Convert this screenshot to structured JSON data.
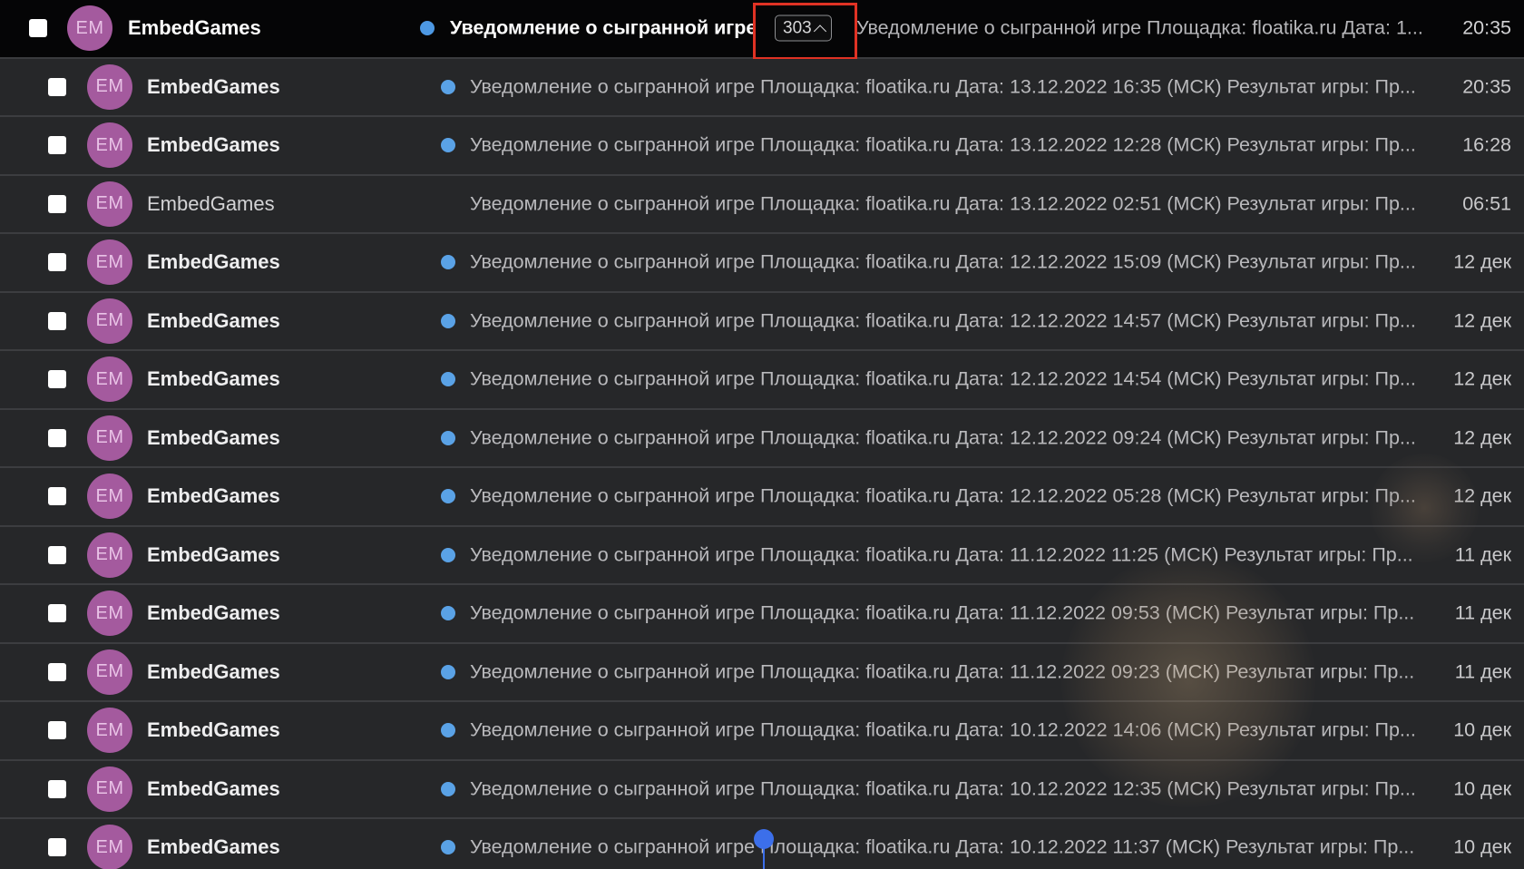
{
  "thread_header": {
    "sender": "EmbedGames",
    "avatar_initials": "EM",
    "subject": "Уведомление о сыгранной игре",
    "count": "303",
    "preview": "Уведомление о сыгранной игре Площадка: floatika.ru Дата: 1...",
    "time": "20:35"
  },
  "messages": [
    {
      "sender": "EmbedGames",
      "avatar_initials": "EM",
      "unread": true,
      "text": "Уведомление о сыгранной игре Площадка: floatika.ru Дата: 13.12.2022 16:35 (МСК) Результат игры: Пр...",
      "time": "20:35"
    },
    {
      "sender": "EmbedGames",
      "avatar_initials": "EM",
      "unread": true,
      "text": "Уведомление о сыгранной игре Площадка: floatika.ru Дата: 13.12.2022 12:28 (МСК) Результат игры: Пр...",
      "time": "16:28"
    },
    {
      "sender": "EmbedGames",
      "avatar_initials": "EM",
      "unread": false,
      "text": "Уведомление о сыгранной игре Площадка: floatika.ru Дата: 13.12.2022 02:51 (МСК) Результат игры: Пр...",
      "time": "06:51"
    },
    {
      "sender": "EmbedGames",
      "avatar_initials": "EM",
      "unread": true,
      "text": "Уведомление о сыгранной игре Площадка: floatika.ru Дата: 12.12.2022 15:09 (МСК) Результат игры: Пр...",
      "time": "12 дек"
    },
    {
      "sender": "EmbedGames",
      "avatar_initials": "EM",
      "unread": true,
      "text": "Уведомление о сыгранной игре Площадка: floatika.ru Дата: 12.12.2022 14:57 (МСК) Результат игры: Пр...",
      "time": "12 дек"
    },
    {
      "sender": "EmbedGames",
      "avatar_initials": "EM",
      "unread": true,
      "text": "Уведомление о сыгранной игре Площадка: floatika.ru Дата: 12.12.2022 14:54 (МСК) Результат игры: Пр...",
      "time": "12 дек"
    },
    {
      "sender": "EmbedGames",
      "avatar_initials": "EM",
      "unread": true,
      "text": "Уведомление о сыгранной игре Площадка: floatika.ru Дата: 12.12.2022 09:24 (МСК) Результат игры: Пр...",
      "time": "12 дек"
    },
    {
      "sender": "EmbedGames",
      "avatar_initials": "EM",
      "unread": true,
      "text": "Уведомление о сыгранной игре Площадка: floatika.ru Дата: 12.12.2022 05:28 (МСК) Результат игры: Пр...",
      "time": "12 дек"
    },
    {
      "sender": "EmbedGames",
      "avatar_initials": "EM",
      "unread": true,
      "text": "Уведомление о сыгранной игре Площадка: floatika.ru Дата: 11.12.2022 11:25 (МСК) Результат игры: Пр...",
      "time": "11 дек"
    },
    {
      "sender": "EmbedGames",
      "avatar_initials": "EM",
      "unread": true,
      "text": "Уведомление о сыгранной игре Площадка: floatika.ru Дата: 11.12.2022 09:53 (МСК) Результат игры: Пр...",
      "time": "11 дек"
    },
    {
      "sender": "EmbedGames",
      "avatar_initials": "EM",
      "unread": true,
      "text": "Уведомление о сыгранной игре Площадка: floatika.ru Дата: 11.12.2022 09:23 (МСК) Результат игры: Пр...",
      "time": "11 дек"
    },
    {
      "sender": "EmbedGames",
      "avatar_initials": "EM",
      "unread": true,
      "text": "Уведомление о сыгранной игре Площадка: floatika.ru Дата: 10.12.2022 14:06 (МСК) Результат игры: Пр...",
      "time": "10 дек"
    },
    {
      "sender": "EmbedGames",
      "avatar_initials": "EM",
      "unread": true,
      "text": "Уведомление о сыгранной игре Площадка: floatika.ru Дата: 10.12.2022 12:35 (МСК) Результат игры: Пр...",
      "time": "10 дек"
    },
    {
      "sender": "EmbedGames",
      "avatar_initials": "EM",
      "unread": true,
      "text": "Уведомление о сыгранной игре Площадка: floatika.ru Дата: 10.12.2022 11:37 (МСК) Результат игры: Пр...",
      "time": "10 дек"
    }
  ],
  "colors": {
    "avatar": "#a45a9e",
    "unread_dot": "#5aa2e6",
    "highlight_box": "#e03224",
    "pointer": "#3c6fea"
  },
  "icons": {
    "expand": "chevron-up-icon",
    "unread": "unread-dot-icon"
  }
}
